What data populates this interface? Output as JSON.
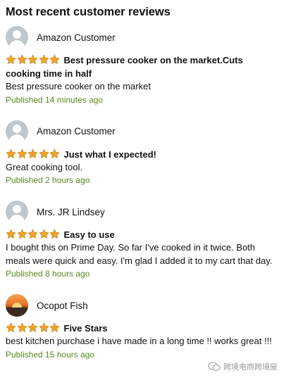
{
  "section_title": "Most recent customer reviews",
  "star_color": "#f0a52a",
  "reviews": [
    {
      "author": "Amazon Customer",
      "avatar": "default-user-icon",
      "rating": 5,
      "title": "Best pressure cooker on the market.Cuts cooking time in half",
      "body": "Best pressure cooker on the market",
      "published": "Published 14 minutes ago"
    },
    {
      "author": "Amazon Customer",
      "avatar": "default-user-icon",
      "rating": 5,
      "title": "Just what I expected!",
      "body": "Great cooking tool.",
      "published": "Published 2 hours ago"
    },
    {
      "author": "Mrs. JR Lindsey",
      "avatar": "default-user-icon",
      "rating": 5,
      "title": "Easy to use",
      "body": "I bought this on Prime Day. So far I've cooked in it twice. Both meals were quick and easy. I'm glad I added it to my cart that day.",
      "published": "Published 8 hours ago"
    },
    {
      "author": "Ocopot Fish",
      "avatar": "sunset-photo",
      "rating": 5,
      "title": "Five Stars",
      "body": "best kitchen purchase i have made in a long time !! works great !!!",
      "published": "Published 15 hours ago"
    }
  ],
  "watermark": {
    "icon": "wechat-icon",
    "text": "跨境电商跨境屋"
  }
}
